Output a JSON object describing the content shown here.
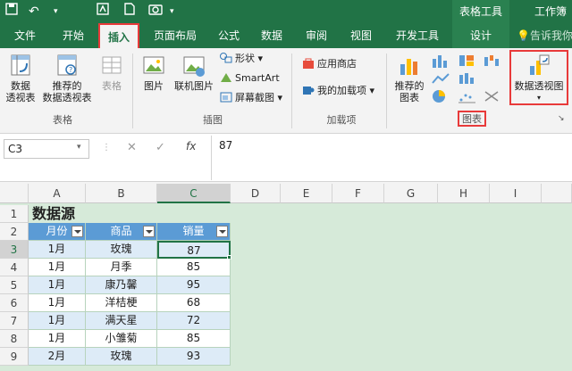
{
  "titlebar": {
    "context_label": "表格工具",
    "workbook_title": "工作簿"
  },
  "tabs": [
    {
      "label": "文件"
    },
    {
      "label": "开始"
    },
    {
      "label": "插入"
    },
    {
      "label": "页面布局"
    },
    {
      "label": "公式"
    },
    {
      "label": "数据"
    },
    {
      "label": "审阅"
    },
    {
      "label": "视图"
    },
    {
      "label": "开发工具"
    },
    {
      "label": "设计"
    }
  ],
  "tell_me": "告诉我你",
  "ribbon": {
    "tables": {
      "pivot": "数据\n透视表",
      "recommended_pivot": "推荐的\n数据透视表",
      "table": "表格",
      "group": "表格"
    },
    "illustrations": {
      "pictures": "图片",
      "online_pictures": "联机图片",
      "shapes": "形状",
      "smartart": "SmartArt",
      "screenshot": "屏幕截图",
      "group": "插图"
    },
    "addins": {
      "store": "应用商店",
      "my_addins": "我的加载项",
      "group": "加载项"
    },
    "charts": {
      "recommended": "推荐的\n图表",
      "group": "图表",
      "pivot_chart": "数据透视图"
    }
  },
  "formula_bar": {
    "name_box": "C3",
    "cancel": "✕",
    "enter": "✓",
    "fx": "fx",
    "value": "87"
  },
  "columns": [
    "A",
    "B",
    "C",
    "D",
    "E",
    "F",
    "G",
    "H",
    "I"
  ],
  "rows": [
    "1",
    "2",
    "3",
    "4",
    "5",
    "6",
    "7",
    "8",
    "9"
  ],
  "sheet": {
    "title": "数据源",
    "headers": [
      "月份",
      "商品",
      "销量"
    ],
    "data": [
      [
        "1月",
        "玫瑰",
        "87"
      ],
      [
        "1月",
        "月季",
        "85"
      ],
      [
        "1月",
        "康乃馨",
        "95"
      ],
      [
        "1月",
        "洋桔梗",
        "68"
      ],
      [
        "1月",
        "满天星",
        "72"
      ],
      [
        "1月",
        "小雏菊",
        "85"
      ],
      [
        "2月",
        "玫瑰",
        "93"
      ]
    ]
  },
  "colors": {
    "accent": "#217346",
    "table_header": "#5b9bd5",
    "highlight": "#e83a3a"
  }
}
